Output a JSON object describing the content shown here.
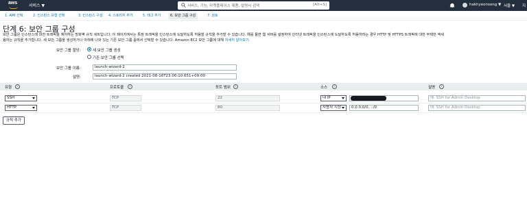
{
  "topnav": {
    "logo_text": "aws",
    "services_label": "서비스 ▼",
    "search_placeholder": "서비스, 기능, 마켓플레이스 제품, 설명서 검색",
    "search_shortcut": "[Alt+S]",
    "user": "hakhyeonsong ▼",
    "region": "서울 ▼",
    "support": "지"
  },
  "tabs": [
    {
      "label": "1. AMI 선택"
    },
    {
      "label": "2. 인스턴스 유형 선택"
    },
    {
      "label": "3. 인스턴스 구성"
    },
    {
      "label": "4. 스토리지 추가"
    },
    {
      "label": "5. 태그 추가"
    },
    {
      "label": "6. 보안 그룹 구성"
    },
    {
      "label": "7. 검토"
    }
  ],
  "page": {
    "title": "단계 6: 보안 그룹 구성",
    "desc_line1": "보안 그룹은 인스턴스에 대한 트래픽을 제어하는 방화벽 규칙 세트입니다. 이 페이지에서는 특정 트래픽을 인스턴스에 도달하도록 허용할 규칙을 추가할 수 있습니다. 예를 들면 웹 서버를 설정하여 인터넷 트래픽을 인스턴스에 도달하도록 허용하려는 경우 HTTP 및 HTTPS 트래픽에 대한 무제한 액세",
    "desc_line2": "용하는 규칙을 추가합니다. 새 보안 그룹을 생성하거나 아래에 나와 있는 기존 보안 그룹 중에서 선택할 수 있습니다. Amazon EC2 보안 그룹에 대해 ",
    "desc_link": "자세히 알아보기."
  },
  "assign": {
    "label": "보안 그룹 할당:",
    "option_new": "새 보안 그룹 생성",
    "option_existing": "기존 보안 그룹 선택"
  },
  "form": {
    "name_label": "보안 그룹 이름:",
    "name_value": "launch-wizard-2",
    "desc_label": "설명:",
    "desc_value": "launch-wizard-2 created 2021-08-16T23:00:10.651+09:00"
  },
  "table": {
    "headers": {
      "type": "유형",
      "protocol": "프로토콜",
      "port": "포트 범위",
      "source": "소스",
      "description": "설명"
    },
    "info": "i",
    "rows": [
      {
        "type": "SSH",
        "protocol": "TCP",
        "port": "22",
        "source_type": "내 IP",
        "source_value": "",
        "description_placeholder": "예: SSH for Admin Desktop"
      },
      {
        "type": "HTTP",
        "protocol": "TCP",
        "port": "80",
        "source_type": "사용자 지정",
        "source_value": "0.0.0.0/0, ::/0",
        "description_placeholder": "예: SSH for Admin Desktop"
      }
    ]
  },
  "add_rule_label": "규칙 추가"
}
